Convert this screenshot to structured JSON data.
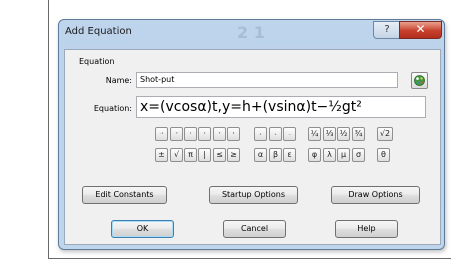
{
  "window": {
    "title": "Add Equation",
    "title_watermark": "2 1",
    "help_glyph": "?",
    "close_glyph": "✕"
  },
  "equation_group": {
    "label": "Equation",
    "name_label": "Name:",
    "name_value": "Shot-put",
    "equation_label": "Equation:",
    "equation_value": "x=(vcosα)t,y=h+(vsinα)t−½gt²"
  },
  "keypad": {
    "row1": [
      "⁻¹",
      "⁰",
      "¹",
      "²",
      "³",
      "⁴",
      "ₓ",
      "₊",
      "₋",
      "¼",
      "⅓",
      "½",
      "¾",
      "√2"
    ],
    "row2": [
      "±",
      "√",
      "π",
      "|",
      "≤",
      "≥",
      "α",
      "β",
      "ε",
      "φ",
      "λ",
      "μ",
      "σ",
      "θ"
    ]
  },
  "buttons": {
    "edit_constants": "Edit Constants",
    "startup_options": "Startup Options",
    "draw_options": "Draw Options",
    "ok": "OK",
    "cancel": "Cancel",
    "help": "Help"
  },
  "colors": {
    "title_bar": "#bed5ec",
    "client_bg": "#f0f0f0",
    "close_button": "#c7402c"
  }
}
